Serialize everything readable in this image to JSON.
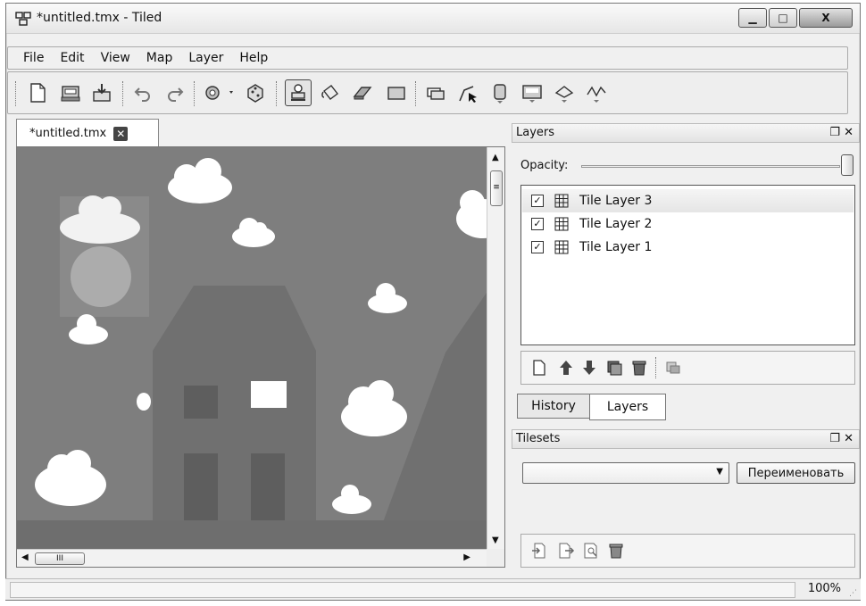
{
  "window": {
    "title": "*untitled.tmx - Tiled",
    "minimize_label": "▁",
    "maximize_label": "□",
    "close_label": "X"
  },
  "menu": [
    "File",
    "Edit",
    "View",
    "Map",
    "Layer",
    "Help"
  ],
  "toolbar": {
    "icons": [
      "new-icon",
      "open-icon",
      "save-icon",
      "undo-icon",
      "redo-icon",
      "commands-icon",
      "random-icon",
      "stamp-brush-icon",
      "bucket-fill-icon",
      "eraser-icon",
      "rectangle-select-icon",
      "select-objects-icon",
      "edit-polygons-icon",
      "insert-rectangle-icon",
      "insert-image-icon",
      "insert-polygon-icon",
      "insert-polyline-icon"
    ],
    "active_tool": "stamp-brush-icon"
  },
  "document_tab": {
    "label": "*untitled.tmx",
    "close_label": "✕"
  },
  "map_view": {
    "background_color": "#7e7e7e",
    "scroll_thumb_label": "≡",
    "hscroll_thumb_label": "III"
  },
  "layers_panel": {
    "title": "Layers",
    "opacity_label": "Opacity:",
    "opacity": 1.0,
    "layers": [
      {
        "name": "Tile Layer 3",
        "visible": true,
        "selected": true
      },
      {
        "name": "Tile Layer 2",
        "visible": true,
        "selected": false
      },
      {
        "name": "Tile Layer 1",
        "visible": true,
        "selected": false
      }
    ],
    "toolbar_icons": [
      "add-layer-icon",
      "move-layer-up-icon",
      "move-layer-down-icon",
      "duplicate-layer-icon",
      "delete-layer-icon",
      "layer-properties-icon"
    ]
  },
  "bottom_tabs": {
    "history": "History",
    "layers": "Layers",
    "active": "Layers"
  },
  "tilesets_panel": {
    "title": "Tilesets",
    "select_value": "",
    "rename_button": "Переименовать",
    "toolbar_icons": [
      "import-tileset-icon",
      "export-tileset-icon",
      "tileset-properties-icon",
      "delete-tileset-icon"
    ]
  },
  "panel_controls": {
    "float_label": "❐",
    "close_label": "✕"
  },
  "statusbar": {
    "zoom": "100%",
    "grip_label": "⋰"
  }
}
